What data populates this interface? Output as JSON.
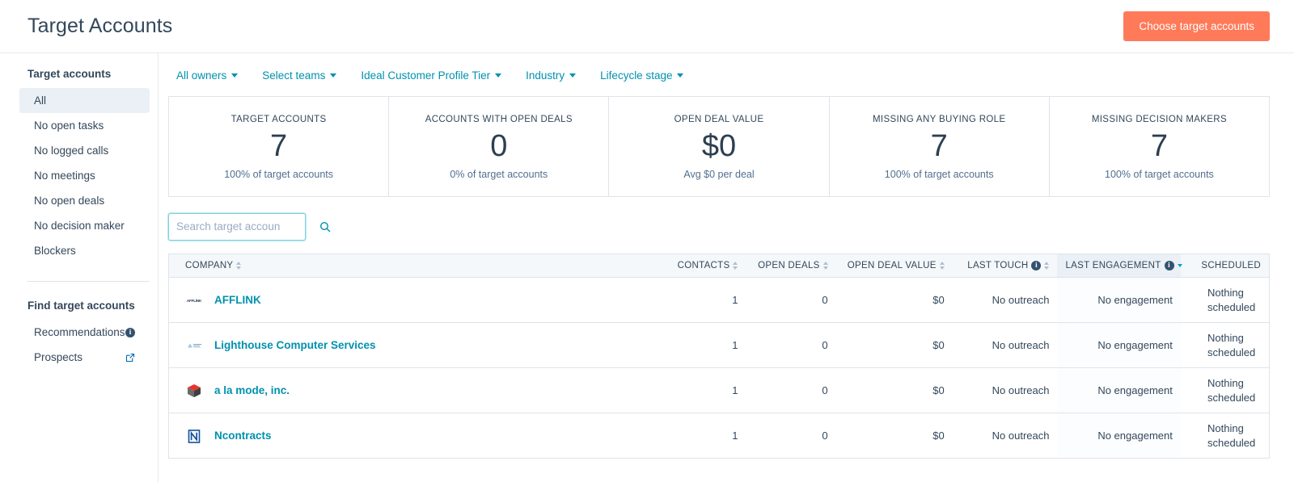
{
  "header": {
    "title": "Target Accounts",
    "primary_button": "Choose target accounts",
    "primary_button_color": "#ff7a59"
  },
  "sidebar": {
    "section1_title": "Target accounts",
    "items": [
      {
        "label": "All",
        "active": true
      },
      {
        "label": "No open tasks",
        "active": false
      },
      {
        "label": "No logged calls",
        "active": false
      },
      {
        "label": "No meetings",
        "active": false
      },
      {
        "label": "No open deals",
        "active": false
      },
      {
        "label": "No decision maker",
        "active": false
      },
      {
        "label": "Blockers",
        "active": false
      }
    ],
    "section2_title": "Find target accounts",
    "links": [
      {
        "label": "Recommendations",
        "icon": "info-icon"
      },
      {
        "label": "Prospects",
        "icon": "external-link-icon"
      }
    ]
  },
  "filters": [
    {
      "label": "All owners"
    },
    {
      "label": "Select teams"
    },
    {
      "label": "Ideal Customer Profile Tier"
    },
    {
      "label": "Industry"
    },
    {
      "label": "Lifecycle stage"
    }
  ],
  "stats": [
    {
      "label": "TARGET ACCOUNTS",
      "value": "7",
      "sub": "100% of target accounts"
    },
    {
      "label": "ACCOUNTS WITH OPEN DEALS",
      "value": "0",
      "sub": "0% of target accounts"
    },
    {
      "label": "OPEN DEAL VALUE",
      "value": "$0",
      "sub": "Avg $0 per deal"
    },
    {
      "label": "MISSING ANY BUYING ROLE",
      "value": "7",
      "sub": "100% of target accounts"
    },
    {
      "label": "MISSING DECISION MAKERS",
      "value": "7",
      "sub": "100% of target accounts"
    }
  ],
  "search": {
    "value": "",
    "placeholder": "Search target accoun",
    "icon": "search-icon",
    "border_color": "#7fd1de"
  },
  "table": {
    "columns": [
      {
        "label": "COMPANY",
        "sortable": true,
        "sorted": false,
        "info": false
      },
      {
        "label": "CONTACTS",
        "sortable": true,
        "sorted": false,
        "info": false
      },
      {
        "label": "OPEN DEALS",
        "sortable": true,
        "sorted": false,
        "info": false
      },
      {
        "label": "OPEN DEAL VALUE",
        "sortable": true,
        "sorted": false,
        "info": false
      },
      {
        "label": "LAST TOUCH",
        "sortable": true,
        "sorted": false,
        "info": true
      },
      {
        "label": "LAST ENGAGEMENT",
        "sortable": true,
        "sorted": true,
        "info": true
      },
      {
        "label": "SCHEDULED",
        "sortable": false,
        "sorted": false,
        "info": false
      }
    ],
    "sort_direction": "descending",
    "rows": [
      {
        "company": "AFFLINK",
        "logo_type": "afflink",
        "contacts": "1",
        "open_deals": "0",
        "open_deal_value": "$0",
        "last_touch": "No outreach",
        "last_engagement": "No engagement",
        "scheduled": "Nothing scheduled"
      },
      {
        "company": "Lighthouse Computer Services",
        "logo_type": "lighthouse",
        "contacts": "1",
        "open_deals": "0",
        "open_deal_value": "$0",
        "last_touch": "No outreach",
        "last_engagement": "No engagement",
        "scheduled": "Nothing scheduled"
      },
      {
        "company": "a la mode, inc.",
        "logo_type": "alamode",
        "contacts": "1",
        "open_deals": "0",
        "open_deal_value": "$0",
        "last_touch": "No outreach",
        "last_engagement": "No engagement",
        "scheduled": "Nothing scheduled"
      },
      {
        "company": "Ncontracts",
        "logo_type": "ncontracts",
        "contacts": "1",
        "open_deals": "0",
        "open_deal_value": "$0",
        "last_touch": "No outreach",
        "last_engagement": "No engagement",
        "scheduled": "Nothing scheduled"
      }
    ]
  },
  "theme": {
    "accent_teal": "#0091ae",
    "link_blue": "#0091ae",
    "text_dark": "#33475b",
    "border": "#dfe3eb",
    "header_bg": "#f5f8fa",
    "sorted_bg": "#eaf0f6"
  }
}
